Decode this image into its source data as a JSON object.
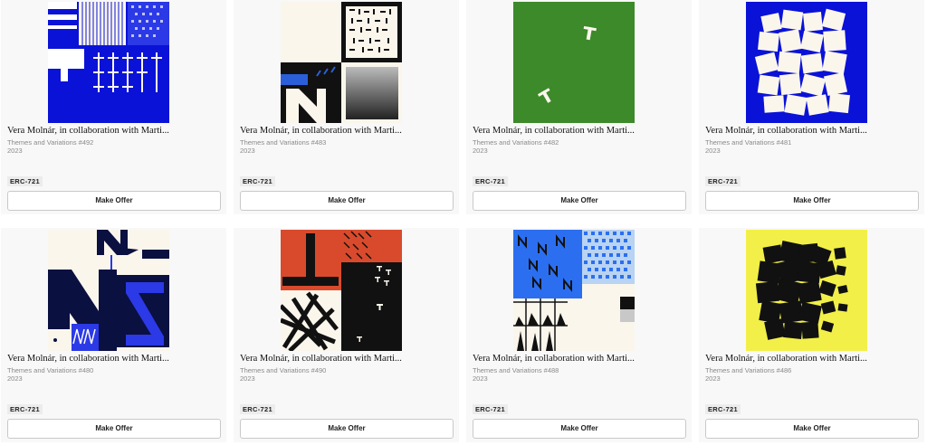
{
  "cards": [
    {
      "title": "Vera Molnár, in collaboration with Marti...",
      "subtitle": "Themes and Variations #492",
      "year": "2023",
      "standard": "ERC-721",
      "button": "Make Offer"
    },
    {
      "title": "Vera Molnár, in collaboration with Marti...",
      "subtitle": "Themes and Variations #483",
      "year": "2023",
      "standard": "ERC-721",
      "button": "Make Offer"
    },
    {
      "title": "Vera Molnár, in collaboration with Marti...",
      "subtitle": "Themes and Variations #482",
      "year": "2023",
      "standard": "ERC-721",
      "button": "Make Offer"
    },
    {
      "title": "Vera Molnár, in collaboration with Marti...",
      "subtitle": "Themes and Variations #481",
      "year": "2023",
      "standard": "ERC-721",
      "button": "Make Offer"
    },
    {
      "title": "Vera Molnár, in collaboration with Marti...",
      "subtitle": "Themes and Variations #480",
      "year": "2023",
      "standard": "ERC-721",
      "button": "Make Offer"
    },
    {
      "title": "Vera Molnár, in collaboration with Marti...",
      "subtitle": "Themes and Variations #490",
      "year": "2023",
      "standard": "ERC-721",
      "button": "Make Offer"
    },
    {
      "title": "Vera Molnár, in collaboration with Marti...",
      "subtitle": "Themes and Variations #488",
      "year": "2023",
      "standard": "ERC-721",
      "button": "Make Offer"
    },
    {
      "title": "Vera Molnár, in collaboration with Marti...",
      "subtitle": "Themes and Variations #486",
      "year": "2023",
      "standard": "ERC-721",
      "button": "Make Offer"
    }
  ],
  "colors": {
    "blue": "#0a12d8",
    "green": "#3c8a2a",
    "red": "#d94a2c",
    "yellow": "#f2f048",
    "cream": "#fbf6ec",
    "black": "#111111"
  },
  "artwork_names": [
    "blue-grid-artwork",
    "cream-black-artwork",
    "green-artwork",
    "blue-squares-artwork",
    "navy-n-artwork",
    "red-black-artwork",
    "blue-n-artwork",
    "yellow-black-artwork"
  ]
}
